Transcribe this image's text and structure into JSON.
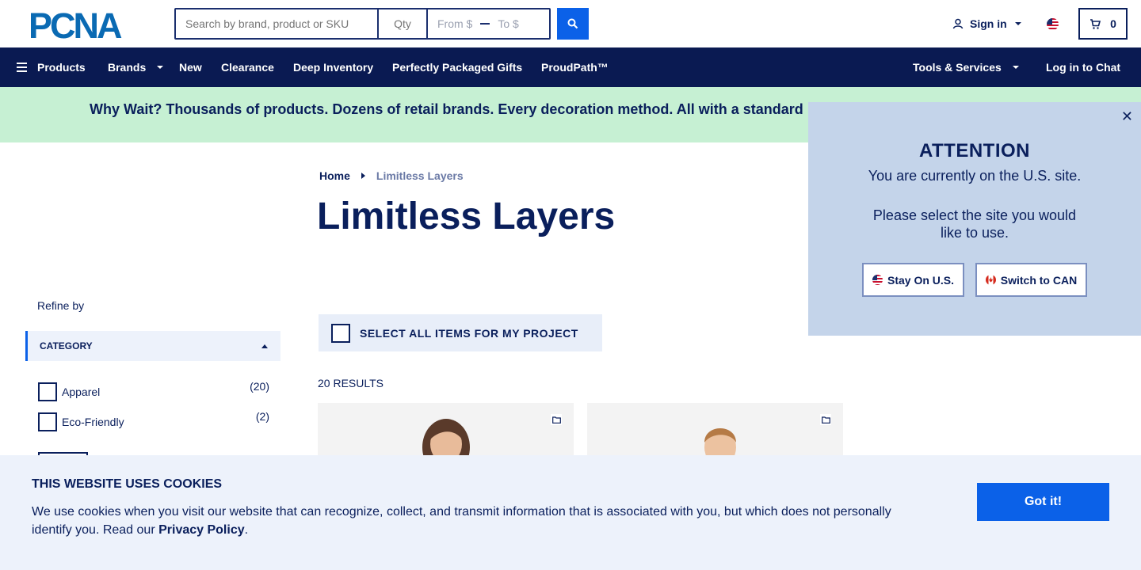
{
  "header": {
    "logo_text": "PCNA",
    "search_placeholder": "Search by brand, product or SKU",
    "qty_placeholder": "Qty",
    "price_from": "From $",
    "price_to": "To $",
    "sign_in": "Sign in",
    "cart_count": "0"
  },
  "nav": {
    "products": "Products",
    "brands": "Brands",
    "new": "New",
    "clearance": "Clearance",
    "deep_inventory": "Deep Inventory",
    "gifts": "Perfectly Packaged Gifts",
    "proudpath": "ProudPath™",
    "tools": "Tools & Services",
    "chat": "Log in to Chat"
  },
  "promo": {
    "text": "Why Wait? Thousands of products. Dozens of retail brands. Every decoration method. All with a standard"
  },
  "breadcrumb": {
    "home": "Home",
    "current": "Limitless Layers"
  },
  "page": {
    "title": "Limitless Layers"
  },
  "filters": {
    "refine_by": "Refine by",
    "category_label": "CATEGORY",
    "items": [
      {
        "label": "Apparel",
        "count": "(20)"
      },
      {
        "label": "Eco-Friendly",
        "count": "(2)"
      }
    ]
  },
  "results": {
    "select_all": "SELECT ALL ITEMS FOR MY PROJECT",
    "count_text": "20 RESULTS"
  },
  "attention": {
    "title": "ATTENTION",
    "line1": "You are currently on the U.S. site.",
    "line2": "Please select the site you would like to use.",
    "stay_button": "Stay On U.S.",
    "switch_button": "Switch to CAN"
  },
  "cookie": {
    "title": "THIS WEBSITE USES COOKIES",
    "text": "We use cookies when you visit our website that can recognize, collect, and transmit information that is associated with you, but which does not personally identify you. Read our ",
    "link": "Privacy Policy",
    "period": ".",
    "button": "Got it!"
  },
  "colors": {
    "brand_navy": "#0a1a52",
    "accent_blue": "#0b61e8",
    "promo_green": "#c6f0d3",
    "popup_blue": "#c4d4ea"
  }
}
